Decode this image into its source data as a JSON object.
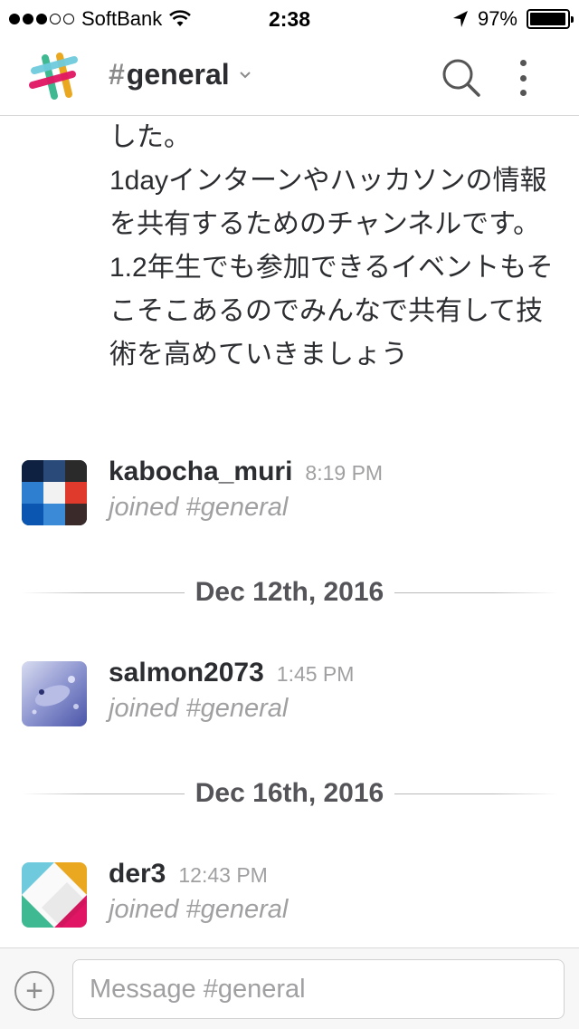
{
  "status_bar": {
    "carrier": "SoftBank",
    "time": "2:38",
    "battery": "97%",
    "battery_level": 0.97,
    "signal_bars_filled": 3,
    "signal_bars_total": 5,
    "icons": [
      "wifi-icon",
      "location-arrow-icon",
      "battery-icon"
    ]
  },
  "header": {
    "channel_hash": "#",
    "channel_name": "general",
    "icons": [
      "slack-logo-icon",
      "chevron-down-icon",
      "search-icon",
      "more-vertical-icon"
    ]
  },
  "messages": {
    "partial_text": "した。\n1dayインターンやハッカソンの情報を共有するためのチャンネルです。\n1.2年生でも参加できるイベントもそこそこあるのでみんなで共有して技術を高めていきましょう",
    "entries": [
      {
        "username": "kabocha_muri",
        "time": "8:19 PM",
        "text": "joined #general"
      },
      {
        "username": "salmon2073",
        "time": "1:45 PM",
        "text": "joined #general"
      },
      {
        "username": "der3",
        "time": "12:43 PM",
        "text": "joined #general"
      }
    ],
    "date_dividers": [
      "Dec 12th, 2016",
      "Dec 16th, 2016"
    ]
  },
  "composer": {
    "add_symbol": "+",
    "placeholder": "Message #general",
    "value": ""
  },
  "colors": {
    "text_primary": "#2c2d30",
    "text_muted": "#a0a0a2",
    "divider_text": "#555459",
    "border": "#d8d8d8"
  }
}
